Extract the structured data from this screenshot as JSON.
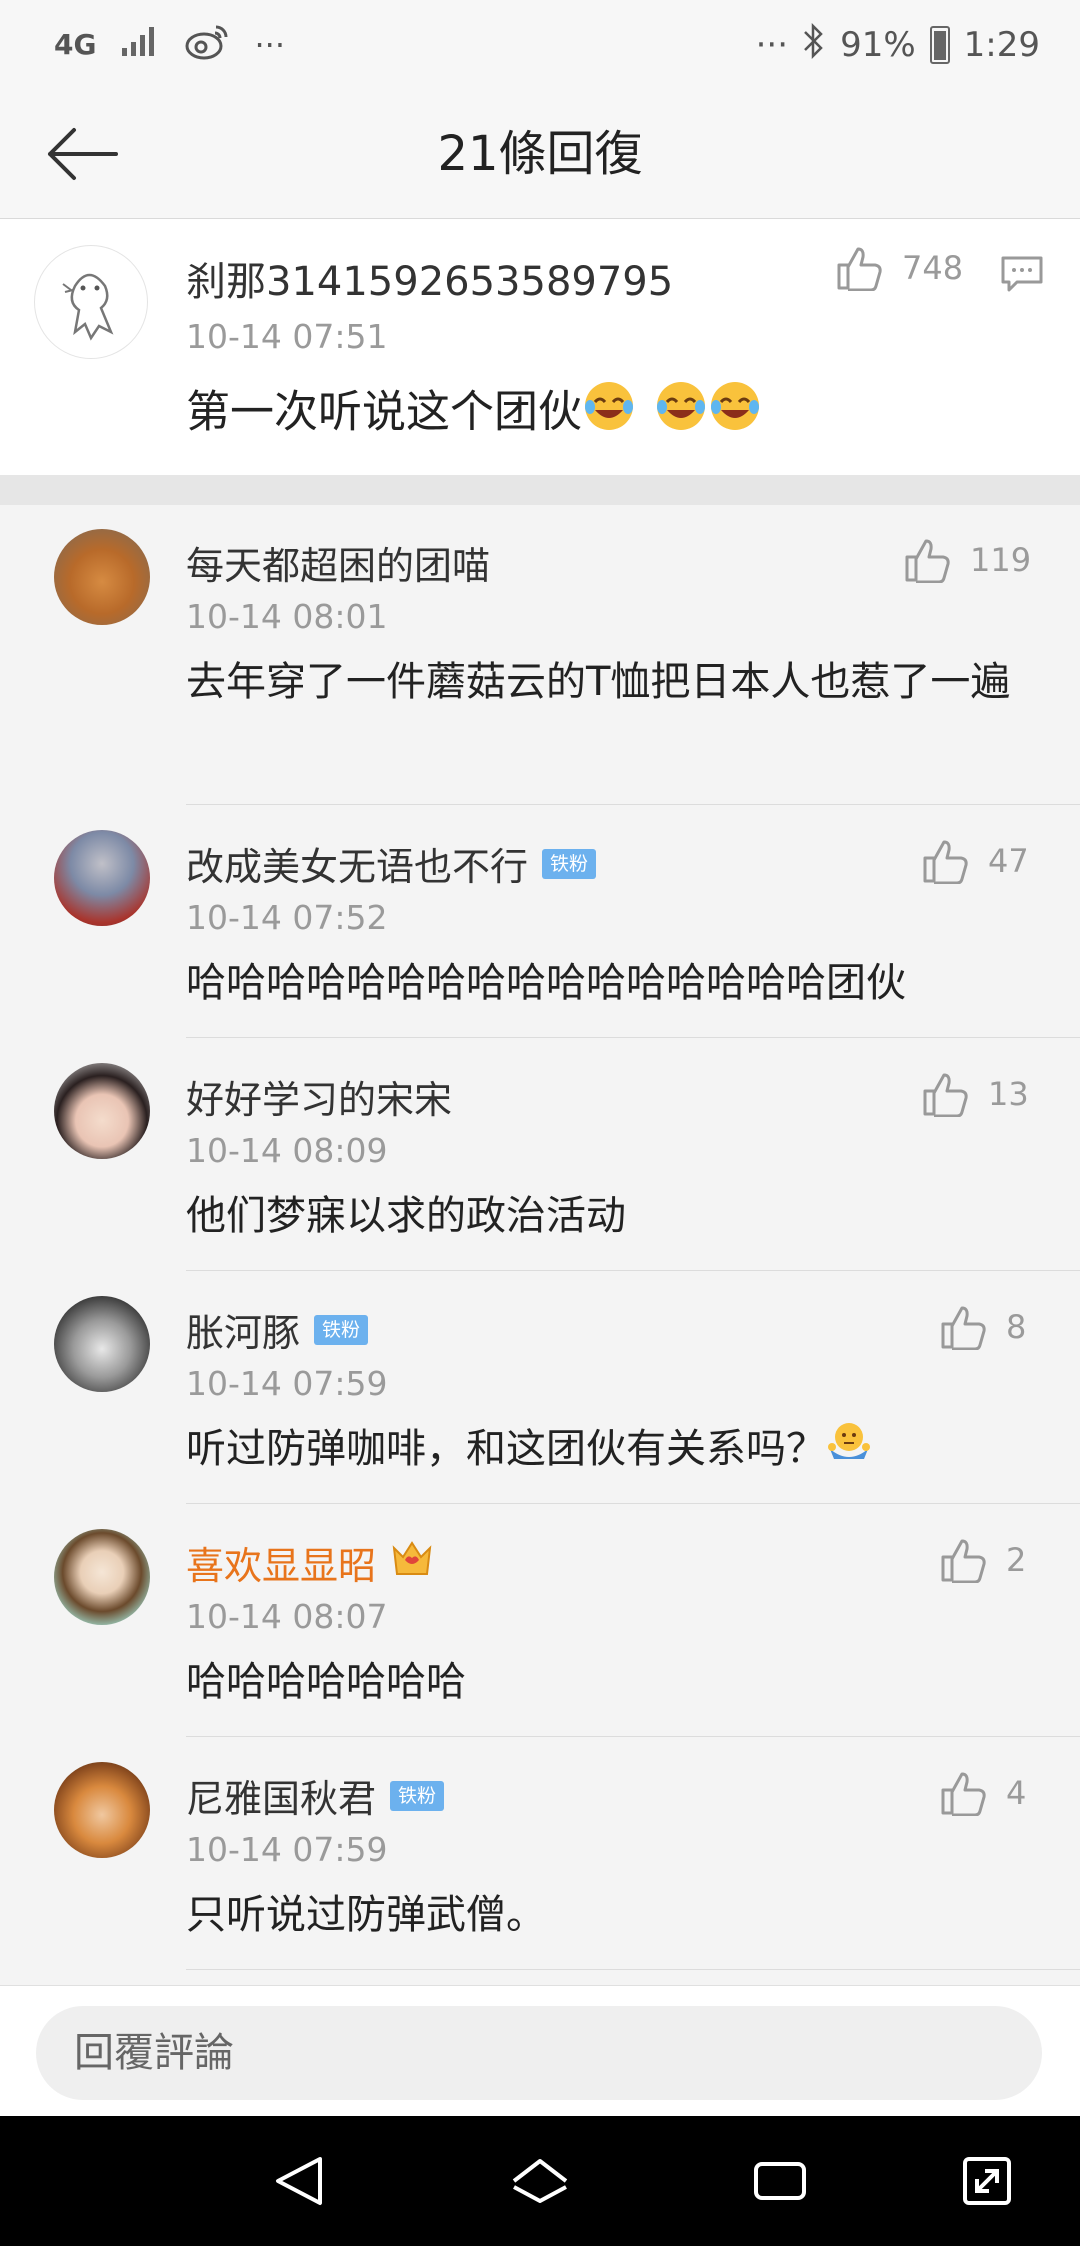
{
  "status_bar": {
    "network": "4G",
    "dots_left": "···",
    "dots_right": "···",
    "battery_percent": "91%",
    "time": "1:29"
  },
  "header": {
    "title": "21條回復"
  },
  "main_comment": {
    "username": "刹那3141592653589795",
    "time": "10-14 07:51",
    "text": "第一次听说这个团伙",
    "likes": "748"
  },
  "replies": [
    {
      "username": "每天都超困的团喵",
      "time": "10-14 08:01",
      "text": "去年穿了一件蘑菇云的T恤把日本人也惹了一遍",
      "likes": "119",
      "badge": ""
    },
    {
      "username": "改成美女无语也不行",
      "time": "10-14 07:52",
      "text": "哈哈哈哈哈哈哈哈哈哈哈哈哈哈哈哈团伙",
      "likes": "47",
      "badge": "铁粉"
    },
    {
      "username": "好好学习的宋宋",
      "time": "10-14 08:09",
      "text": "他们梦寐以求的政治活动",
      "likes": "13",
      "badge": ""
    },
    {
      "username": "胀河豚",
      "time": "10-14 07:59",
      "text": "听过防弹咖啡，和这团伙有关系吗？",
      "likes": "8",
      "badge": "铁粉"
    },
    {
      "username": "喜欢显显昭",
      "time": "10-14 08:07",
      "text": "哈哈哈哈哈哈哈",
      "likes": "2",
      "badge": ""
    },
    {
      "username": "尼雅国秋君",
      "time": "10-14 07:59",
      "text": "只听说过防弹武僧。",
      "likes": "4",
      "badge": "铁粉"
    }
  ],
  "input": {
    "placeholder": "回覆評論"
  },
  "colors": {
    "accent_gold": "#e8741b",
    "badge_blue": "#6cb1ee",
    "text_gray": "#9a9a9a"
  },
  "icons": [
    "signal-icon",
    "weibo-icon",
    "bluetooth-icon",
    "battery-icon",
    "back-arrow-icon",
    "thumbs-up-icon",
    "comment-icon",
    "crown-icon",
    "nav-back-icon",
    "nav-home-icon",
    "nav-recents-icon",
    "nav-expand-icon"
  ]
}
